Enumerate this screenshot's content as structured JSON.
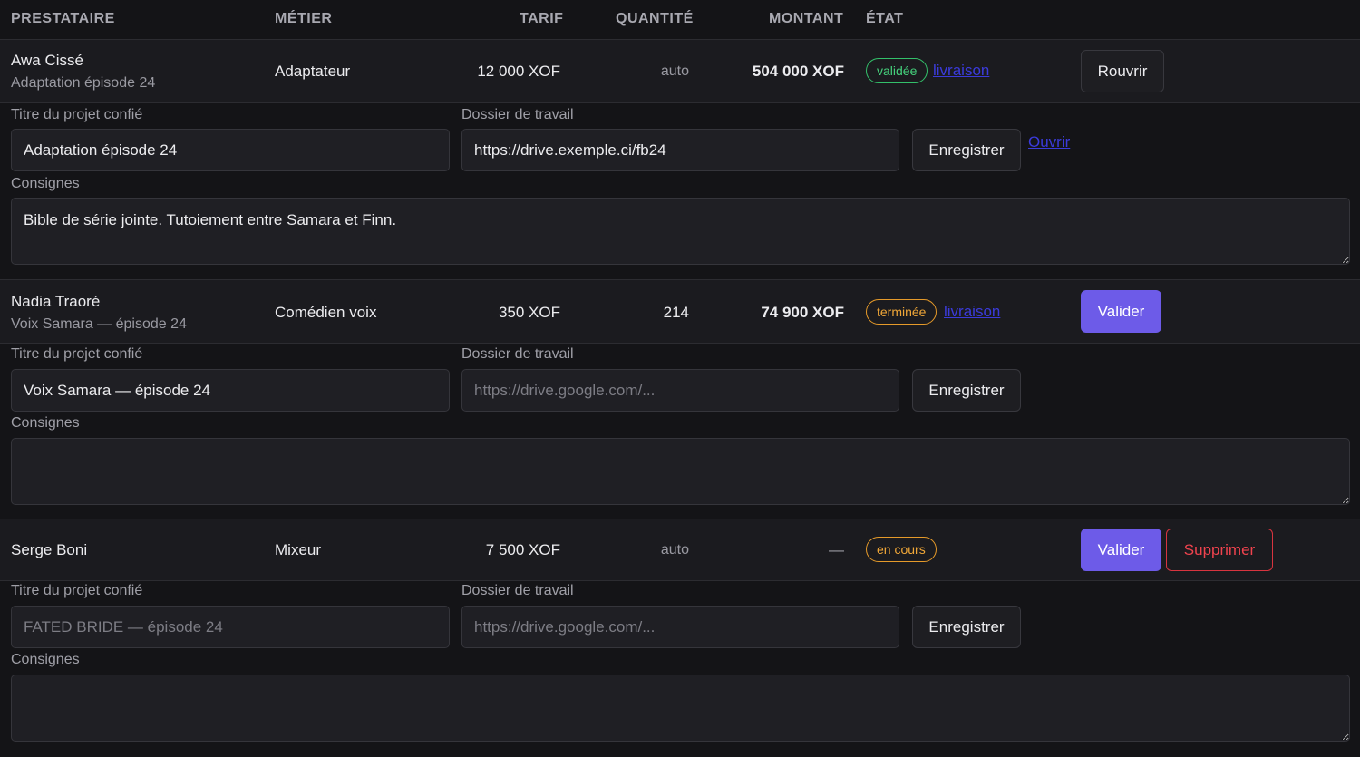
{
  "headers": {
    "prestataire": "PRESTATAIRE",
    "metier": "MÉTIER",
    "tarif": "TARIF",
    "quantite": "QUANTITÉ",
    "montant": "MONTANT",
    "etat": "ÉTAT"
  },
  "labels": {
    "titre": "Titre du projet confié",
    "dossier": "Dossier de travail",
    "consignes": "Consignes",
    "enregistrer": "Enregistrer",
    "dossier_placeholder": "https://drive.google.com/..."
  },
  "rows": [
    {
      "name": "Awa Cissé",
      "subtitle": "Adaptation épisode 24",
      "metier": "Adaptateur",
      "tarif": "12 000 XOF",
      "quantite": "auto",
      "montant": "504 000 XOF",
      "status": "validée",
      "status_color": "#45d17c",
      "link": "livraison",
      "action": "Rouvrir",
      "titre_value": "Adaptation épisode 24",
      "titre_placeholder": "",
      "dossier_value": "https://drive.exemple.ci/fb24",
      "ouvrir": "Ouvrir",
      "consignes_value": "Bible de série jointe. Tutoiement entre Samara et Finn."
    },
    {
      "name": "Nadia Traoré",
      "subtitle": "Voix Samara — épisode 24",
      "metier": "Comédien voix",
      "tarif": "350 XOF",
      "quantite": "214",
      "montant": "74 900 XOF",
      "status": "terminée",
      "status_color": "#f0a738",
      "link": "livraison",
      "action": "Valider",
      "titre_value": "Voix Samara — épisode 24",
      "titre_placeholder": "",
      "dossier_value": "",
      "consignes_value": ""
    },
    {
      "name": "Serge Boni",
      "subtitle": "",
      "metier": "Mixeur",
      "tarif": "7 500 XOF",
      "quantite": "auto",
      "montant": "—",
      "status": "en cours",
      "status_color": "#f0a738",
      "action": "Valider",
      "action2": "Supprimer",
      "titre_value": "",
      "titre_placeholder": "FATED BRIDE — épisode 24",
      "dossier_value": "",
      "consignes_value": ""
    }
  ],
  "colors": {
    "background": "#141417",
    "row": "#1b1b1f",
    "primary": "#6d5be8",
    "danger": "#f0434e",
    "link": "#3b3bdb"
  }
}
